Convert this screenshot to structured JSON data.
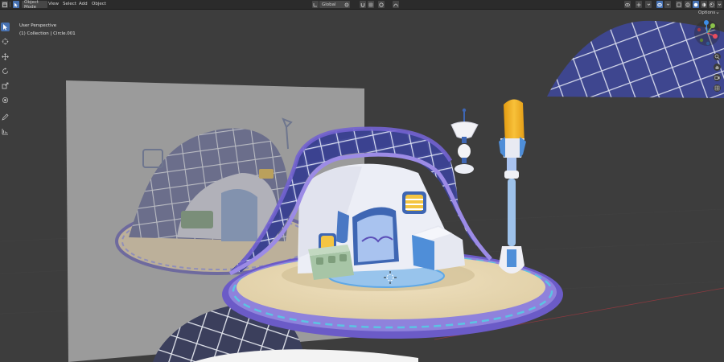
{
  "header": {
    "mode_label": "Object Mode",
    "menus": [
      "View",
      "Select",
      "Add",
      "Object"
    ],
    "orientation_label": "Global",
    "options_label": "Options"
  },
  "viewport": {
    "perspective_label": "User Perspective",
    "collection_label": "(1) Collection | Circle.001"
  },
  "toolbar": {
    "tools": [
      "select-box",
      "cursor",
      "move",
      "rotate",
      "scale",
      "transform",
      "annotate",
      "measure"
    ],
    "active_tool": "select-box"
  },
  "gizmo": {
    "axes": [
      "X",
      "Y",
      "Z"
    ],
    "colors": {
      "x": "#e84d5f",
      "y": "#8bc34a",
      "z": "#3d8ee8"
    }
  },
  "colors": {
    "accent": "#4772b3",
    "viewport_bg": "#3d3d3d",
    "header_bg": "#2b2b2b",
    "dome_blue": "#434996",
    "dome_dark": "#2b2f6e",
    "tile_lines": "#d7dcf0",
    "sand_floor": "#ead9b5",
    "rim_purple": "#7d6bd1",
    "lamp_yellow": "#f2b52a",
    "house_wall": "#e9eaf2",
    "window_yellow": "#f4c542",
    "blocks_green": "#a7c5a6"
  }
}
